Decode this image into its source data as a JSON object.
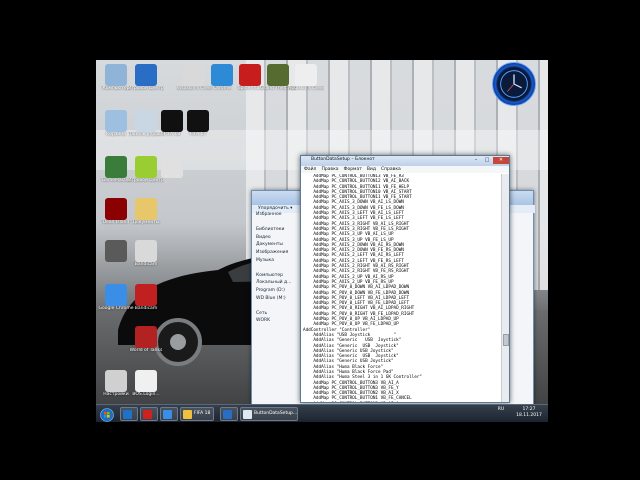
{
  "desktop": {
    "icons": [
      {
        "label": "Компьютер",
        "color": "#8fb4d8"
      },
      {
        "label": "Игровой Центр",
        "color": "#2a6dc4"
      },
      {
        "label": "Assassin's Creed",
        "color": "#d9d9d9"
      },
      {
        "label": "Chrome",
        "color": "#2d8ad6"
      },
      {
        "label": "Spiderman",
        "color": "#c81d1d"
      },
      {
        "label": "Grand Theft Auto V",
        "color": "#556b2f"
      },
      {
        "label": "Assassin's Creed III",
        "color": "#eeeeee"
      },
      {
        "label": "Корзина",
        "color": "#9dc0e0"
      },
      {
        "label": "Панель управления",
        "color": "#c9d6e3"
      },
      {
        "label": "FIFA 18",
        "color": "#101010"
      },
      {
        "label": "FIFA 17",
        "color": "#111111"
      },
      {
        "label": "GameMaster",
        "color": "#3a7d3a"
      },
      {
        "label": "Игровой Центр",
        "color": "#9acd32"
      },
      {
        "label": "",
        "color": "#e0e0e0"
      },
      {
        "label": "Dead Island",
        "color": "#8b0000"
      },
      {
        "label": "Документы",
        "color": "#e8c66a"
      },
      {
        "label": "",
        "color": "#5a5a5a"
      },
      {
        "label": "Bandicam",
        "color": "#d9d9d9"
      },
      {
        "label": "Google Chrome",
        "color": "#3a8ee6"
      },
      {
        "label": "Bandicam",
        "color": "#c02020"
      },
      {
        "label": "World of Tanks",
        "color": "#b22222"
      },
      {
        "label": "Настройки",
        "color": "#d0d0d0"
      },
      {
        "label": "BOS.Login...",
        "color": "#f0f0f0"
      }
    ]
  },
  "explorer": {
    "title": "",
    "organize": "Упорядочить ▾",
    "nav": [
      "Избранное",
      "",
      "Библиотеки",
      "Видео",
      "Документы",
      "Изображения",
      "Музыка",
      "",
      "Компьютер",
      "Локальный д...",
      "Program (D:)",
      "WD Blue (M:)",
      "",
      "Сеть",
      "WORK"
    ]
  },
  "notepad": {
    "title": "ButtonDataSetup – Блокнот",
    "menu": [
      "Файл",
      "Правка",
      "Формат",
      "Вид",
      "Справка"
    ],
    "lines": [
      "    AddMap PC_CONTROL_BUTTON13 VB_FE_R3",
      "    AddMap PC_CONTROL_BUTTON12 VB_AI_BACK",
      "    AddMap PC_CONTROL_BUTTON11 VB_FE_HELP",
      "    AddMap PC_CONTROL_BUTTON10 VB_AI_START",
      "    AddMap PC_CONTROL_BUTTON11 VB_FE_START",
      "    AddMap PC_AXIS_3_DOWN VB_AI_LS_DOWN",
      "    AddMap PC_AXIS_3_DOWN VB_FE_LS_DOWN",
      "    AddMap PC_AXIS_3_LEFT VB_AI_LS_LEFT",
      "    AddMap PC_AXIS_3_LEFT VB_FE_LS_LEFT",
      "    AddMap PC_AXIS_3_RIGHT VB_AI_LS_RIGHT",
      "    AddMap PC_AXIS_3_RIGHT VB_FE_LS_RIGHT",
      "    AddMap PC_AXIS_3_UP VB_AI_LS_UP",
      "    AddMap PC_AXIS_3_UP VB_FE_LS_UP",
      "    AddMap PC_AXIS_2_DOWN VB_AI_RS_DOWN",
      "    AddMap PC_AXIS_2_DOWN VB_FE_RS_DOWN",
      "    AddMap PC_AXIS_2_LEFT VB_AI_RS_LEFT",
      "    AddMap PC_AXIS_2_LEFT VB_FE_RS_LEFT",
      "    AddMap PC_AXIS_2_RIGHT VB_AI_RS_RIGHT",
      "    AddMap PC_AXIS_2_RIGHT VB_FE_RS_RIGHT",
      "    AddMap PC_AXIS_2_UP VB_AI_RS_UP",
      "    AddMap PC_AXIS_2_UP VB_FE_RS_UP",
      "    AddMap PC_POV_0_DOWN VB_AI_LDPAD_DOWN",
      "    AddMap PC_POV_0_DOWN VB_FE_LDPAD_DOWN",
      "    AddMap PC_POV_0_LEFT VB_AI_LDPAD_LEFT",
      "    AddMap PC_POV_0_LEFT VB_FE_LDPAD_LEFT",
      "    AddMap PC_POV_0_RIGHT VB_AI_LDPAD_RIGHT",
      "    AddMap PC_POV_0_RIGHT VB_FE_LDPAD_RIGHT",
      "    AddMap PC_POV_0_UP VB_AI_LDPAD_UP",
      "    AddMap PC_POV_0_UP VB_FE_LDPAD_UP",
      "AddController \"Controller\"",
      "",
      "    AddAlias \"USB Joystick         \"",
      "",
      "    AddAlias \"Generic   USB  Joystick\"",
      "    AddAlias \"Generic  USB  Joystick\"",
      "    AddAlias \"Generic USB Joystick\"",
      "    AddAlias \"Generic  USB  Joystick\"",
      "    AddAlias \"Generic USB Joystick\"",
      "    AddAlias \"Huma Black Force\"",
      "    AddAlias \"Huma Black Force Pad\"",
      "    AddAlias \"Huma Steel 3 in 1 GK Controller\"",
      "    AddMap PC_CONTROL_BUTTON3 VB_AI_A",
      "    AddMap PC_CONTROL_BUTTON3 VB_FE_Y",
      "    AddMap PC_CONTROL_BUTTON2 VB_AI_X",
      "    AddMap PC_CONTROL_BUTTON1 VB_FE_CANCEL",
      "    AddMap PC_CONTROL_BUTTON3 VB_AI_A",
      "    AddMap PC_CONTROL_BUTTON2 VB_FE_SELECT",
      "    AddMap PC_CONTROL_BUTTON4 VB_AI_L"
    ]
  },
  "taskbar": {
    "items": [
      {
        "label": "",
        "color": "#1e73c8"
      },
      {
        "label": "",
        "color": "#d02020"
      },
      {
        "label": "",
        "color": "#3a8ee6"
      },
      {
        "label": "FIFA 18",
        "color": "#f0c040"
      },
      {
        "label": "",
        "color": "#2a6dc4"
      },
      {
        "label": "ButtonDataSetup...",
        "color": "#dfe8f2"
      }
    ],
    "lang": "RU",
    "time": "17:27",
    "date": "18.11.2017"
  }
}
